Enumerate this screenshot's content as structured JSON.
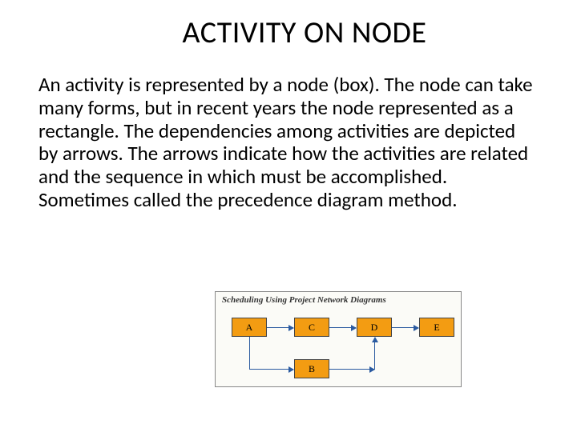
{
  "title": "ACTIVITY ON NODE",
  "body": "An activity is represented by a node (box). The node can take many forms, but in recent years the node represented as a rectangle. The dependencies among activities are depicted by arrows. The arrows indicate how the activities are related and the sequence in which must be accomplished. Sometimes called  the precedence diagram method.",
  "diagram": {
    "caption": "Scheduling Using Project Network Diagrams",
    "nodes": {
      "a": "A",
      "b": "B",
      "c": "C",
      "d": "D",
      "e": "E"
    }
  }
}
